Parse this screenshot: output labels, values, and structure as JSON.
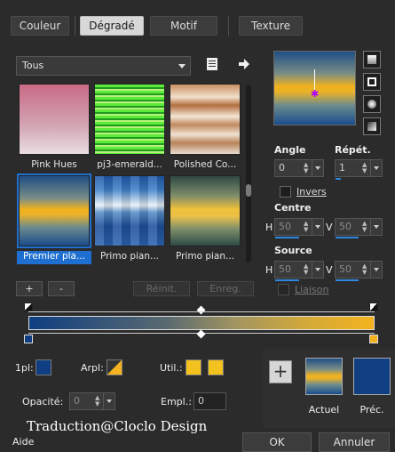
{
  "tabs": [
    "Couleur",
    "Dégradé",
    "Motif",
    "Texture"
  ],
  "active_tab": "Dégradé",
  "dropdown": {
    "value": "Tous"
  },
  "gallery": {
    "items": [
      {
        "label": "Pink Hues"
      },
      {
        "label": "pj3-emerald..."
      },
      {
        "label": "Polished Co..."
      },
      {
        "label": "Premier pla..."
      },
      {
        "label": "Primo pian..."
      },
      {
        "label": "Primo pian..."
      }
    ],
    "selected": "Premier pla..."
  },
  "angle": {
    "label": "Angle",
    "value": "0"
  },
  "repeat": {
    "label": "Répét.",
    "value": "1"
  },
  "invert": {
    "label": "Invers"
  },
  "center": {
    "label": "Centre",
    "h_label": "H",
    "h_value": "50",
    "v_label": "V",
    "v_value": "50"
  },
  "source": {
    "label": "Source",
    "h_label": "H",
    "h_value": "50",
    "v_label": "V",
    "v_value": "50"
  },
  "link": {
    "label": "Liaison"
  },
  "buttons": {
    "add": "+",
    "remove": "-",
    "reset": "Réinit.",
    "save": "Enreg."
  },
  "stops": {
    "pl_label": "1pl:",
    "arpl_label": "Arpl:",
    "util_label": "Util.:",
    "opacity_label": "Opacité:",
    "opacity_value": "0",
    "empl_label": "Empl.:",
    "empl_value": "0"
  },
  "compare": {
    "current": "Actuel",
    "previous": "Préc."
  },
  "footer": {
    "help": "Aide",
    "ok": "OK",
    "cancel": "Annuler"
  },
  "watermark": "Traduction@Cloclo Design",
  "colors": {
    "accent_blue": "#1e6fd0",
    "gold": "#f4b31e",
    "navy": "#0f3f82"
  }
}
